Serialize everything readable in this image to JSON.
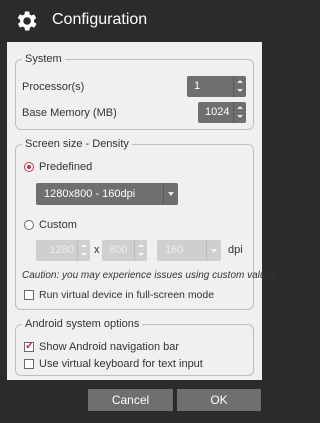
{
  "window": {
    "title": "Configuration",
    "icon": "gear-icon"
  },
  "system": {
    "legend": "System",
    "processors_label": "Processor(s)",
    "processors_value": "1",
    "memory_label": "Base Memory (MB)",
    "memory_value": "1024"
  },
  "screen": {
    "legend": "Screen size - Density",
    "predefined_label": "Predefined",
    "predefined_selected": true,
    "predefined_value": "1280x800 - 160dpi",
    "custom_label": "Custom",
    "custom_selected": false,
    "custom_width": "1280",
    "custom_x": "x",
    "custom_height": "800",
    "custom_density": "160",
    "dpi_label": "dpi",
    "caution": "Caution: you may experience issues using custom values",
    "fullscreen_label": "Run virtual device in full-screen mode",
    "fullscreen_checked": false
  },
  "android": {
    "legend": "Android system options",
    "navbar_label": "Show Android navigation bar",
    "navbar_checked": true,
    "keyboard_label": "Use virtual keyboard for text input",
    "keyboard_checked": false
  },
  "buttons": {
    "cancel": "Cancel",
    "ok": "OK"
  },
  "colors": {
    "accent": "#c0304b",
    "control": "#6f6f6f",
    "panel": "#f0f0f0",
    "frame": "#2b2b2b"
  }
}
